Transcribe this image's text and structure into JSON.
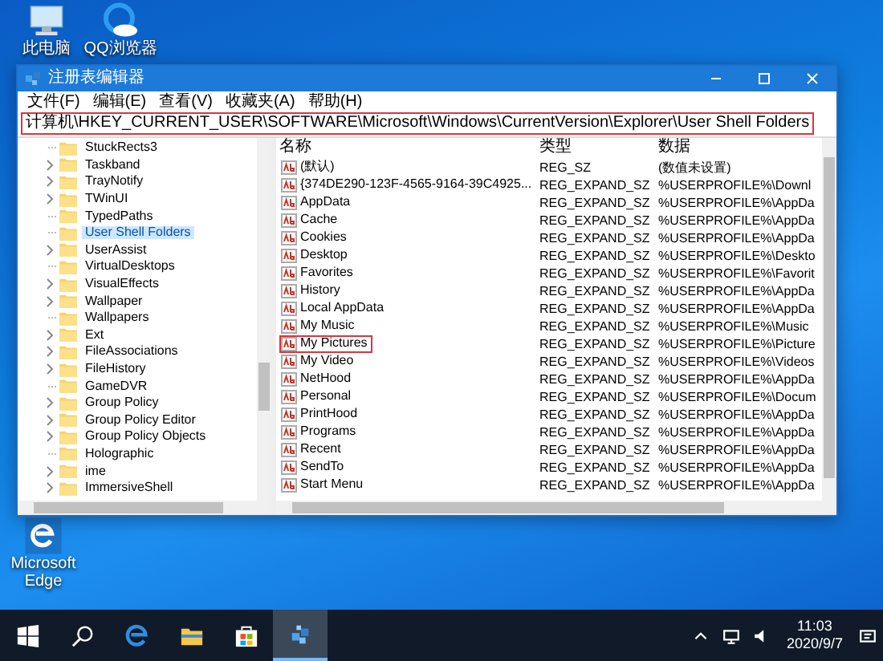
{
  "desktop_icons": [
    {
      "kind": "computer",
      "label": "此电脑"
    },
    {
      "kind": "qq-browser",
      "label": "QQ浏览器"
    },
    {
      "kind": "edge",
      "label": "Microsoft Edge"
    }
  ],
  "window": {
    "title": "注册表编辑器"
  },
  "menu": [
    "文件(F)",
    "编辑(E)",
    "查看(V)",
    "收藏夹(A)",
    "帮助(H)"
  ],
  "address": {
    "value": "计算机\\HKEY_CURRENT_USER\\SOFTWARE\\Microsoft\\Windows\\CurrentVersion\\Explorer\\User Shell Folders",
    "highlighted": true
  },
  "tree": {
    "items": [
      {
        "children": [
          {
            "label": "StuckRects3",
            "expandable": false,
            "selected": false
          },
          {
            "label": "Taskband",
            "expandable": true,
            "selected": false
          },
          {
            "label": "TrayNotify",
            "expandable": true,
            "selected": false
          },
          {
            "label": "TWinUI",
            "expandable": true,
            "selected": false
          },
          {
            "label": "TypedPaths",
            "expandable": false,
            "selected": false
          },
          {
            "label": "User Shell Folders",
            "expandable": false,
            "selected": true
          },
          {
            "label": "UserAssist",
            "expandable": true,
            "selected": false
          },
          {
            "label": "VirtualDesktops",
            "expandable": false,
            "selected": false
          },
          {
            "label": "VisualEffects",
            "expandable": true,
            "selected": false
          },
          {
            "label": "Wallpaper",
            "expandable": true,
            "selected": false
          },
          {
            "label": "Wallpapers",
            "expandable": false,
            "selected": false
          }
        ]
      },
      {
        "label": "Ext",
        "expandable": true,
        "selected": false
      },
      {
        "label": "FileAssociations",
        "expandable": true,
        "selected": false
      },
      {
        "label": "FileHistory",
        "expandable": true,
        "selected": false
      },
      {
        "label": "GameDVR",
        "expandable": false,
        "selected": false
      },
      {
        "label": "Group Policy",
        "expandable": true,
        "selected": false
      },
      {
        "label": "Group Policy Editor",
        "expandable": true,
        "selected": false
      },
      {
        "label": "Group Policy Objects",
        "expandable": true,
        "selected": false
      },
      {
        "label": "Holographic",
        "expandable": false,
        "selected": false
      },
      {
        "label": "ime",
        "expandable": true,
        "selected": false
      },
      {
        "label": "ImmersiveShell",
        "expandable": true,
        "selected": false
      }
    ]
  },
  "values": {
    "columns": [
      "名称",
      "类型",
      "数据"
    ],
    "rows": [
      {
        "name": "(默认)",
        "type": "REG_SZ",
        "data": "(数值未设置)",
        "highlighted": false
      },
      {
        "name": "{374DE290-123F-4565-9164-39C4925...",
        "type": "REG_EXPAND_SZ",
        "data": "%USERPROFILE%\\Downl",
        "highlighted": false
      },
      {
        "name": "AppData",
        "type": "REG_EXPAND_SZ",
        "data": "%USERPROFILE%\\AppDa",
        "highlighted": false
      },
      {
        "name": "Cache",
        "type": "REG_EXPAND_SZ",
        "data": "%USERPROFILE%\\AppDa",
        "highlighted": false
      },
      {
        "name": "Cookies",
        "type": "REG_EXPAND_SZ",
        "data": "%USERPROFILE%\\AppDa",
        "highlighted": false
      },
      {
        "name": "Desktop",
        "type": "REG_EXPAND_SZ",
        "data": "%USERPROFILE%\\Deskto",
        "highlighted": false
      },
      {
        "name": "Favorites",
        "type": "REG_EXPAND_SZ",
        "data": "%USERPROFILE%\\Favorit",
        "highlighted": false
      },
      {
        "name": "History",
        "type": "REG_EXPAND_SZ",
        "data": "%USERPROFILE%\\AppDa",
        "highlighted": false
      },
      {
        "name": "Local AppData",
        "type": "REG_EXPAND_SZ",
        "data": "%USERPROFILE%\\AppDa",
        "highlighted": false
      },
      {
        "name": "My Music",
        "type": "REG_EXPAND_SZ",
        "data": "%USERPROFILE%\\Music",
        "highlighted": false
      },
      {
        "name": "My Pictures",
        "type": "REG_EXPAND_SZ",
        "data": "%USERPROFILE%\\Picture",
        "highlighted": true
      },
      {
        "name": "My Video",
        "type": "REG_EXPAND_SZ",
        "data": "%USERPROFILE%\\Videos",
        "highlighted": false
      },
      {
        "name": "NetHood",
        "type": "REG_EXPAND_SZ",
        "data": "%USERPROFILE%\\AppDa",
        "highlighted": false
      },
      {
        "name": "Personal",
        "type": "REG_EXPAND_SZ",
        "data": "%USERPROFILE%\\Docum",
        "highlighted": false
      },
      {
        "name": "PrintHood",
        "type": "REG_EXPAND_SZ",
        "data": "%USERPROFILE%\\AppDa",
        "highlighted": false
      },
      {
        "name": "Programs",
        "type": "REG_EXPAND_SZ",
        "data": "%USERPROFILE%\\AppDa",
        "highlighted": false
      },
      {
        "name": "Recent",
        "type": "REG_EXPAND_SZ",
        "data": "%USERPROFILE%\\AppDa",
        "highlighted": false
      },
      {
        "name": "SendTo",
        "type": "REG_EXPAND_SZ",
        "data": "%USERPROFILE%\\AppDa",
        "highlighted": false
      },
      {
        "name": "Start Menu",
        "type": "REG_EXPAND_SZ",
        "data": "%USERPROFILE%\\AppDa",
        "highlighted": false
      }
    ]
  },
  "taskbar": {
    "apps": [
      {
        "kind": "start",
        "active": false
      },
      {
        "kind": "search",
        "active": false
      },
      {
        "kind": "edge",
        "active": false
      },
      {
        "kind": "explorer",
        "active": false
      },
      {
        "kind": "store",
        "active": false
      },
      {
        "kind": "regedit",
        "active": true
      }
    ],
    "time": "11:03",
    "date": "2020/9/7"
  }
}
